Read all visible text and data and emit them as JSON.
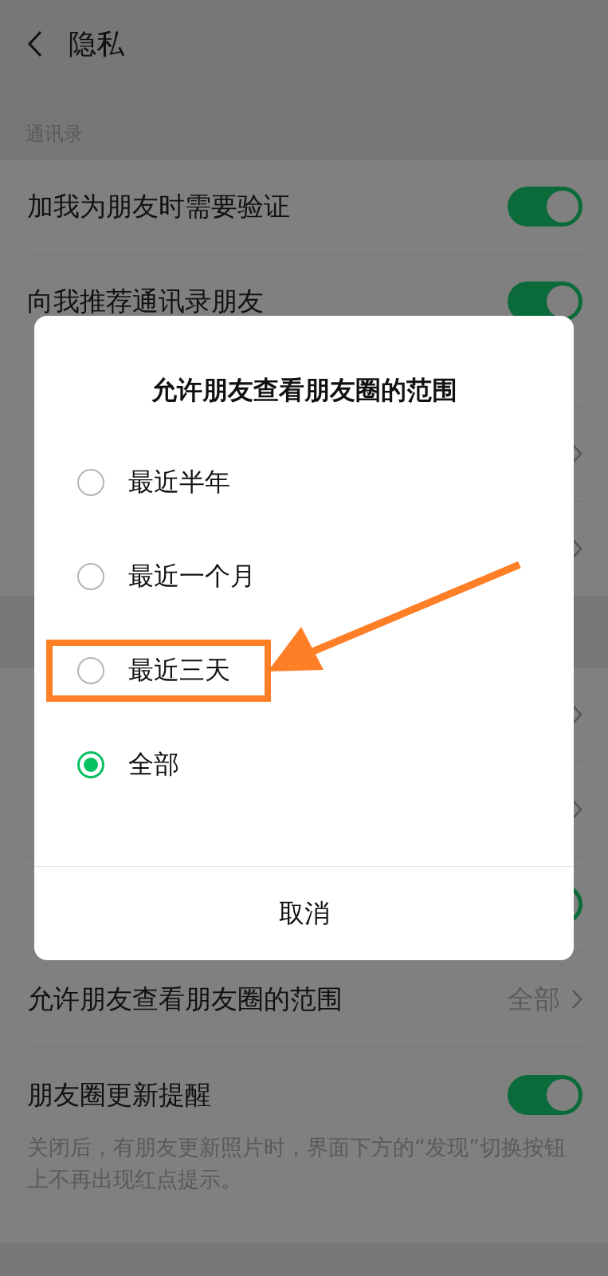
{
  "header": {
    "title": "隐私"
  },
  "sections": [
    {
      "label": "通讯录",
      "rows": [
        {
          "kind": "toggle",
          "label": "加我为朋友时需要验证",
          "on": true
        },
        {
          "kind": "toggle",
          "label": "向我推荐通讯录朋友",
          "on": true
        },
        {
          "kind": "link"
        },
        {
          "kind": "link"
        }
      ]
    },
    {
      "rows": [
        {
          "kind": "link"
        },
        {
          "kind": "link"
        },
        {
          "kind": "toggle",
          "on": true
        },
        {
          "kind": "link",
          "label": "允许朋友查看朋友圈的范围",
          "value": "全部"
        },
        {
          "kind": "toggle",
          "label": "朋友圈更新提醒",
          "on": true,
          "description": "关闭后，有朋友更新照片时，界面下方的“发现”切换按钮上不再出现红点提示。"
        }
      ]
    }
  ],
  "dialog": {
    "title": "允许朋友查看朋友圈的范围",
    "options": [
      {
        "label": "最近半年",
        "selected": false
      },
      {
        "label": "最近一个月",
        "selected": false
      },
      {
        "label": "最近三天",
        "selected": false,
        "highlighted": true
      },
      {
        "label": "全部",
        "selected": true
      }
    ],
    "cancel": "取消"
  }
}
